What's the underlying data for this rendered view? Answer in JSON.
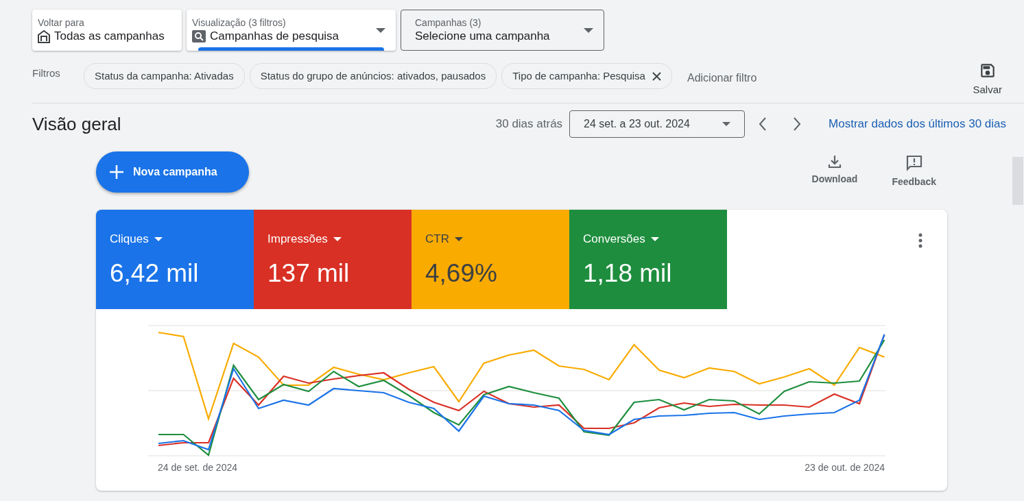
{
  "selectors": [
    {
      "kind": "back",
      "label": "Voltar para",
      "value": "Todas as campanhas",
      "selected": false
    },
    {
      "kind": "view",
      "label": "Visualização (3 filtros)",
      "value": "Campanhas de pesquisa",
      "selected": true
    },
    {
      "kind": "campaign",
      "label": "Campanhas (3)",
      "value": "Selecione uma campanha",
      "selected": false
    }
  ],
  "filters": {
    "label": "Filtros",
    "chips": [
      {
        "text": "Status da campanha: Ativadas",
        "removable": false
      },
      {
        "text": "Status do grupo de anúncios: ativados, pausados",
        "removable": false
      },
      {
        "text": "Tipo de campanha: Pesquisa",
        "removable": true
      }
    ],
    "add_filter": "Adicionar filtro",
    "save": "Salvar"
  },
  "overview": {
    "title": "Visão geral",
    "range_label": "30 dias atrás",
    "date_range": "24 set. a 23 out. 2024",
    "show_last": "Mostrar dados dos últimos 30 dias"
  },
  "new_campaign": "Nova campanha",
  "actions": [
    {
      "kind": "download",
      "label": "Download"
    },
    {
      "kind": "feedback",
      "label": "Feedback"
    }
  ],
  "metrics": [
    {
      "name": "Cliques",
      "value": "6,42 mil",
      "color": "#1a73e8"
    },
    {
      "name": "Impressões",
      "value": "137 mil",
      "color": "#d93025"
    },
    {
      "name": "CTR",
      "value": "4,69%",
      "color": "#f9ab00"
    },
    {
      "name": "Conversões",
      "value": "1,18 mil",
      "color": "#1e8e3e"
    }
  ],
  "chart": {
    "x_start": "24 de set. de 2024",
    "x_end": "23 de out. de 2024"
  }
}
